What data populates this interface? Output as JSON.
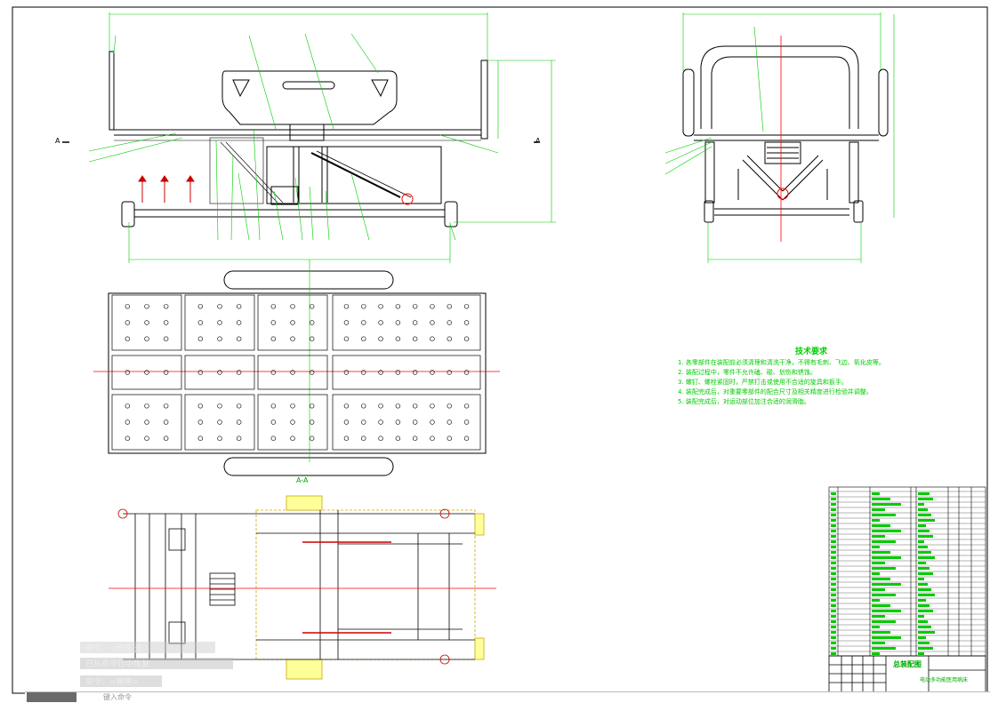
{
  "drawing": {
    "section_label": "A-A",
    "section_mark_left": "A",
    "section_mark_right": "A",
    "title_block_name": "总装配图",
    "title_block_sub": "电动多功能医用病床"
  },
  "tech_requirements": {
    "title": "技术要求",
    "lines": [
      "1. 各零部件在装配前必须清理和清洗干净，不得有毛刺、飞边、氧化皮等。",
      "2. 装配过程中，零件不允许磕、碰、划伤和锈蚀。",
      "3. 螺钉、螺栓紧固时，严禁打击或使用不合适的旋具和扳手。",
      "4. 装配完成后，对重要零部件的配合尺寸及相关精度进行检验并调整。",
      "5. 装配完成后，对运动部位加注合适的润滑脂。"
    ]
  },
  "command_window": {
    "line1": "命令：<栅格 关>",
    "line2": "已从命令行中恢复",
    "line3": "命令：<栅格>",
    "prompt": "键入命令"
  },
  "colors": {
    "line": "#000000",
    "dim": "#00cc00",
    "center": "#ff0000",
    "hidden": "#ccaa00"
  }
}
